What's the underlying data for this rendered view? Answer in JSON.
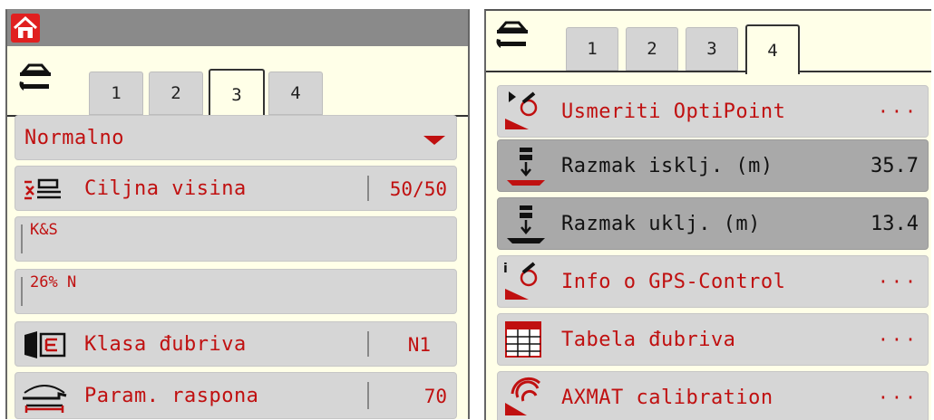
{
  "left_panel": {
    "tabs": [
      "1",
      "2",
      "3",
      "4"
    ],
    "active_tab": "3",
    "mode_select": "Normalno",
    "target_height": {
      "label": "Ciljna visina",
      "value": "50/50"
    },
    "product_name": "K&S",
    "product_type": "26% N",
    "fertilizer_class": {
      "label": "Klasa đubriva",
      "value": "N1"
    },
    "spread_params": {
      "label": "Param. raspona",
      "value": "70"
    }
  },
  "right_panel": {
    "tabs": [
      "1",
      "2",
      "3",
      "4"
    ],
    "active_tab": "4",
    "items": [
      {
        "label": "Usmeriti OptiPoint",
        "value": "···"
      },
      {
        "label": "Razmak isklj. (m)",
        "value": "35.7"
      },
      {
        "label": "Razmak uklj. (m)",
        "value": "13.4"
      },
      {
        "label": "Info o GPS-Control",
        "value": "···"
      },
      {
        "label": "Tabela đubriva",
        "value": "···"
      },
      {
        "label": "AXMAT calibration",
        "value": "···"
      }
    ]
  },
  "colors": {
    "accent": "#c01010",
    "panel_bg": "#ffffe8",
    "row_bg": "#d6d6d6",
    "row_selected": "#a9a9a9",
    "titlebar": "#8a8a8a"
  },
  "icons": [
    "home-icon",
    "setup-wrench-icon",
    "dropdown-caret-icon",
    "target-height-icon",
    "fertilizer-class-icon",
    "spread-params-icon",
    "optipoint-icon",
    "distance-off-icon",
    "distance-on-icon",
    "gps-info-icon",
    "fertilizer-table-icon",
    "axmat-icon"
  ]
}
